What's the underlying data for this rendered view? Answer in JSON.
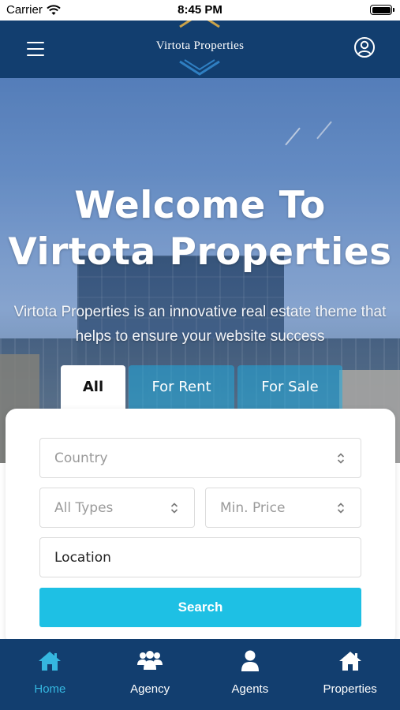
{
  "status_bar": {
    "carrier": "Carrier",
    "time": "8:45 PM",
    "icons": [
      "wifi-icon",
      "battery-icon"
    ]
  },
  "header": {
    "logo_text": "Virtota Properties",
    "menu_icon": "hamburger-icon",
    "profile_icon": "user-circle-icon"
  },
  "hero": {
    "title_line1": "Welcome To",
    "title_line2": "Virtota Properties",
    "subtitle_line1": "Virtota Properties is an innovative real estate theme that",
    "subtitle_line2": "helps to ensure your website success"
  },
  "tabs": [
    {
      "label": "All",
      "active": true
    },
    {
      "label": "For Rent",
      "active": false
    },
    {
      "label": "For Sale",
      "active": false
    }
  ],
  "search": {
    "country_placeholder": "Country",
    "types_placeholder": "All Types",
    "price_placeholder": "Min. Price",
    "location_value": "Location",
    "button_label": "Search"
  },
  "bottom_nav": [
    {
      "label": "Home",
      "icon": "home-icon",
      "active": true
    },
    {
      "label": "Agency",
      "icon": "group-icon",
      "active": false
    },
    {
      "label": "Agents",
      "icon": "person-icon",
      "active": false
    },
    {
      "label": "Properties",
      "icon": "house-icon",
      "active": false
    }
  ],
  "colors": {
    "header_bg": "#123e6f",
    "accent": "#1ec0e4",
    "active_nav": "#35b7e0",
    "logo_chevron": "#c9a24a"
  }
}
